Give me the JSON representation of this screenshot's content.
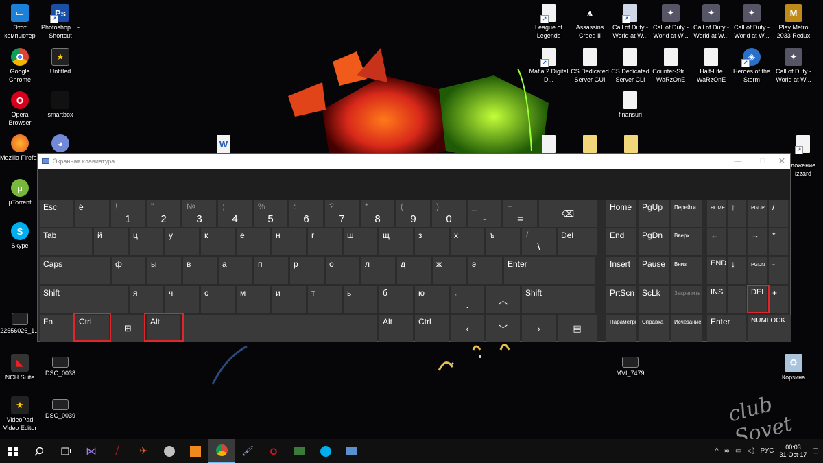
{
  "desktop": {
    "left_column": [
      {
        "label": "Этот компьютер",
        "icon": "monitor-icon"
      },
      {
        "label": "Google Chrome",
        "icon": "chrome-icon"
      },
      {
        "label": "Opera Browser",
        "icon": "opera-icon"
      },
      {
        "label": "Mozilla Firefox",
        "icon": "firefox-icon"
      },
      {
        "label": "µTorrent",
        "icon": "utorrent-icon"
      },
      {
        "label": "Skype",
        "icon": "skype-icon"
      },
      {
        "label": "22556026_1...",
        "icon": "video-file-icon"
      },
      {
        "label": "NCH Suite",
        "icon": "nch-icon"
      },
      {
        "label": "VideoPad Video Editor",
        "icon": "videopad-icon"
      }
    ],
    "second_column": [
      {
        "label": "Photoshop... - Shortcut",
        "icon": "photoshop-icon"
      },
      {
        "label": "Untitled",
        "icon": "star-icon"
      },
      {
        "label": "smartbox",
        "icon": "folder-icon"
      },
      {
        "label": "",
        "icon": "discord-icon"
      },
      {
        "label": "DSC_0038",
        "icon": "video-file-icon"
      },
      {
        "label": "DSC_0039",
        "icon": "video-file-icon"
      }
    ],
    "top_right": [
      {
        "label": "League of Legends",
        "icon": "shortcut-file-icon"
      },
      {
        "label": "Assassins Creed II",
        "icon": "assassins-icon"
      },
      {
        "label": "Call of Duty - World at W...",
        "icon": "cod-icon"
      },
      {
        "label": "Call of Duty - World at W...",
        "icon": "cod-icon"
      },
      {
        "label": "Call of Duty - World at W...",
        "icon": "cod-icon"
      },
      {
        "label": "Call of Duty - World at W...",
        "icon": "cod-icon"
      },
      {
        "label": "Play Metro 2033 Redux",
        "icon": "metro-icon"
      }
    ],
    "second_right_row": [
      {
        "label": "Mafia 2.Digital D...",
        "icon": "shortcut-file-icon"
      },
      {
        "label": "CS Dedicated Server GUI",
        "icon": "file-icon"
      },
      {
        "label": "CS Dedicated Server CLI",
        "icon": "file-icon"
      },
      {
        "label": "Counter-Str... WaRzOnE",
        "icon": "file-icon"
      },
      {
        "label": "Half-Life WaRzOnE",
        "icon": "file-icon"
      },
      {
        "label": "Heroes of the Storm",
        "icon": "heroes-icon"
      },
      {
        "label": "Call of Duty - World at W...",
        "icon": "cod-icon"
      }
    ],
    "finansuri": {
      "label": "finansuri",
      "icon": "file-icon"
    },
    "partial_right": {
      "label": "ложение izzard",
      "icon": "shortcut-file-icon"
    },
    "mvi": {
      "label": "MVI_7479",
      "icon": "video-file-icon"
    },
    "recycle": {
      "label": "Корзина",
      "icon": "recycle-bin-icon"
    }
  },
  "osk": {
    "title": "Экранная клавиатура",
    "window_buttons": {
      "minimize": "—",
      "maximize": "□",
      "close": "✕"
    },
    "rows": [
      [
        {
          "top": "Esc"
        },
        {
          "top": "ё"
        },
        {
          "shift": "!",
          "main": "1"
        },
        {
          "shift": "\"",
          "main": "2"
        },
        {
          "shift": "№",
          "main": "3"
        },
        {
          "shift": ";",
          "main": "4"
        },
        {
          "shift": "%",
          "main": "5"
        },
        {
          "shift": ":",
          "main": "6"
        },
        {
          "shift": "?",
          "main": "7"
        },
        {
          "shift": "*",
          "main": "8"
        },
        {
          "shift": "(",
          "main": "9"
        },
        {
          "shift": ")",
          "main": "0"
        },
        {
          "shift": "_",
          "main": "-"
        },
        {
          "shift": "+",
          "main": "="
        },
        {
          "center": "⌫"
        }
      ],
      [
        {
          "top": "Tab"
        },
        {
          "top": "й"
        },
        {
          "top": "ц"
        },
        {
          "top": "у"
        },
        {
          "top": "к"
        },
        {
          "top": "е"
        },
        {
          "top": "н"
        },
        {
          "top": "г"
        },
        {
          "top": "ш"
        },
        {
          "top": "щ"
        },
        {
          "top": "з"
        },
        {
          "top": "х"
        },
        {
          "top": "ъ"
        },
        {
          "shift": "/",
          "main": "\\"
        },
        {
          "top": "Del"
        }
      ],
      [
        {
          "top": "Caps"
        },
        {
          "top": "ф"
        },
        {
          "top": "ы"
        },
        {
          "top": "в"
        },
        {
          "top": "а"
        },
        {
          "top": "п"
        },
        {
          "top": "р"
        },
        {
          "top": "о"
        },
        {
          "top": "л"
        },
        {
          "top": "д"
        },
        {
          "top": "ж"
        },
        {
          "top": "э"
        },
        {
          "top": "Enter"
        }
      ],
      [
        {
          "top": "Shift"
        },
        {
          "top": "я"
        },
        {
          "top": "ч"
        },
        {
          "top": "с"
        },
        {
          "top": "м"
        },
        {
          "top": "и"
        },
        {
          "top": "т"
        },
        {
          "top": "ь"
        },
        {
          "top": "б"
        },
        {
          "top": "ю"
        },
        {
          "shift": ",",
          "main": "."
        },
        {
          "center": "︿"
        },
        {
          "top": "Shift"
        }
      ],
      [
        {
          "top": "Fn"
        },
        {
          "top": "Ctrl"
        },
        {
          "center": "⊞"
        },
        {
          "top": "Alt"
        },
        {
          "top": ""
        },
        {
          "top": "Alt"
        },
        {
          "top": "Ctrl"
        },
        {
          "center": "‹"
        },
        {
          "center": "﹀"
        },
        {
          "center": "›"
        },
        {
          "center": "▤"
        }
      ]
    ],
    "nav_block": [
      [
        "Home",
        "PgUp",
        "Перейти"
      ],
      [
        "End",
        "PgDn",
        "Вверх"
      ],
      [
        "Insert",
        "Pause",
        "Вниз"
      ],
      [
        "PrtScn",
        "ScLk",
        "Закрепить"
      ],
      [
        "Параметры",
        "Справка",
        "Исчезание"
      ]
    ],
    "numpad": [
      [
        "HOME",
        "↑",
        "PGUP",
        "/"
      ],
      [
        "←",
        "",
        "→",
        "*"
      ],
      [
        "END",
        "↓",
        "PGDN",
        "-"
      ],
      [
        "INS",
        "",
        "DEL",
        "+"
      ],
      [
        "Enter",
        "",
        "NUMLOCK",
        ""
      ]
    ]
  },
  "taskbar": {
    "items": [
      "windows-start-icon",
      "search-icon",
      "task-view-icon",
      "visual-studio-icon",
      "acrobat-icon",
      "app-icon",
      "app-icon",
      "app-icon",
      "chrome-icon",
      "paint-icon",
      "opera-icon",
      "app-icon",
      "skype-icon",
      "app-icon"
    ],
    "language": "РУС",
    "time": "00:03",
    "date": "31-Oct-17"
  },
  "watermark": "club Sovet",
  "colors": {
    "highlight": "#e0262b",
    "key": "#3a3a3a",
    "osk_bg": "#2b2b2b",
    "taskbar": "#101010"
  }
}
